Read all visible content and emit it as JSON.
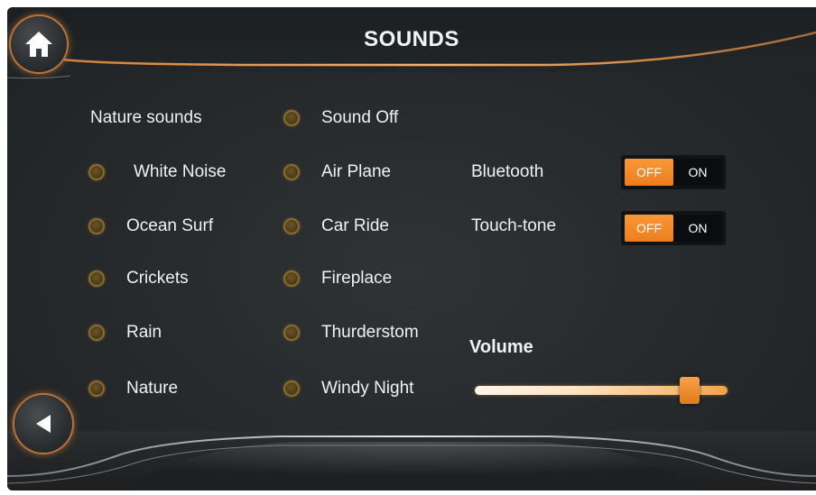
{
  "header": {
    "title": "SOUNDS"
  },
  "navigation": {
    "home_icon": "home-icon",
    "back_icon": "back-arrow-icon"
  },
  "sounds": {
    "heading": "Nature sounds",
    "left_column": [
      {
        "label": "White Noise"
      },
      {
        "label": "Ocean Surf"
      },
      {
        "label": "Crickets"
      },
      {
        "label": "Rain"
      },
      {
        "label": "Nature"
      }
    ],
    "right_column": [
      {
        "label": "Sound Off"
      },
      {
        "label": "Air Plane"
      },
      {
        "label": "Car Ride"
      },
      {
        "label": "Fireplace"
      },
      {
        "label": "Thurderstom"
      },
      {
        "label": "Windy Night"
      }
    ]
  },
  "settings": {
    "bluetooth": {
      "label": "Bluetooth",
      "off": "OFF",
      "on": "ON",
      "state": "OFF"
    },
    "touch_tone": {
      "label": "Touch-tone",
      "off": "OFF",
      "on": "ON",
      "state": "OFF"
    }
  },
  "volume": {
    "label": "Volume",
    "level": 0.88
  },
  "colors": {
    "accent": "#ee7d1c",
    "background": "#26292b",
    "text": "#f1f1f1",
    "glow": "#d9823a"
  }
}
